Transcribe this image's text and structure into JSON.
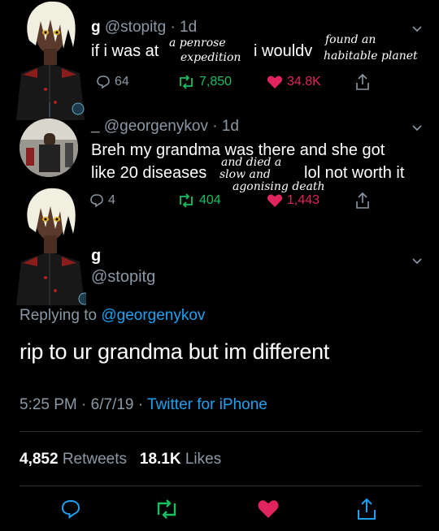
{
  "tweet1": {
    "name": "g",
    "handle": "@stopitg",
    "time": "· 1d",
    "text_a": "if i was at",
    "text_b": "i wouldv",
    "hand_note_1": "a penrose",
    "hand_note_1b": "expedition",
    "hand_note_2": "found an",
    "hand_note_2b": "habitable planet",
    "replies": "64",
    "retweets": "7,850",
    "likes": "34.8K"
  },
  "tweet2": {
    "name": "_",
    "handle": "@georgenykov",
    "time": "· 1d",
    "line1": "Breh my grandma was there and she got",
    "line2a": "like 20 diseases",
    "line2b": "lol not worth it",
    "hand_note_a": "and died a",
    "hand_note_b": "slow and",
    "hand_note_c": "agonising death",
    "replies": "4",
    "retweets": "404",
    "likes": "1,443"
  },
  "main_tweet": {
    "name": "g",
    "handle": "@stopitg",
    "replying_label": "Replying to",
    "replying_handle": "@georgenykov",
    "text": "rip to ur grandma but im different",
    "time": "5:25 PM · 6/7/19 ·",
    "source": "Twitter for iPhone",
    "retweet_count": "4,852",
    "retweet_label": "Retweets",
    "like_count": "18.1K",
    "like_label": "Likes"
  },
  "colors": {
    "background": "#000000",
    "muted": "#8b98a5",
    "retweet": "#17bf63",
    "like": "#e0245e",
    "link": "#1da1f2"
  },
  "icons": [
    "reply-icon",
    "retweet-icon",
    "like-icon",
    "share-icon",
    "chevron-down-icon"
  ]
}
